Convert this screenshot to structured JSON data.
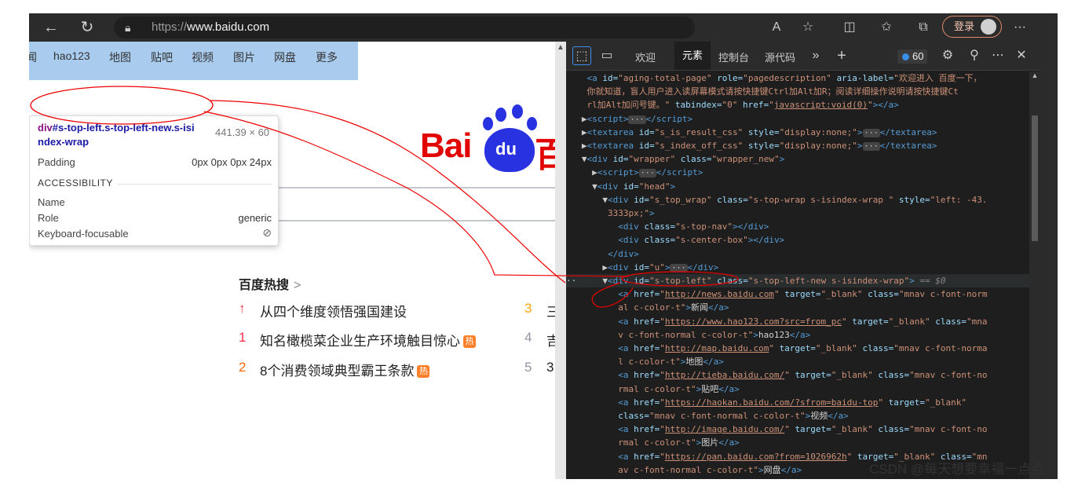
{
  "browser": {
    "url_prefix": "https://",
    "url_host": "www.baidu.com",
    "login_label": "登录",
    "icons": [
      "back-icon",
      "refresh-icon",
      "lock-icon",
      "read-aloud-icon",
      "favorite-add-icon",
      "split-screen-icon",
      "favorites-icon",
      "collections-icon",
      "more-icon"
    ]
  },
  "page": {
    "nav": [
      "闻",
      "hao123",
      "地图",
      "贴吧",
      "视频",
      "图片",
      "网盘",
      "更多"
    ],
    "logo_text": "Bai",
    "logo_du": "du",
    "logo_cut": "百",
    "hot_title": "百度热搜",
    "hot_arrow": ">",
    "hot_list": [
      {
        "idx": "↑",
        "text": "从四个维度领悟强国建设",
        "tag": "",
        "color": "#fe2d46"
      },
      {
        "idx": "1",
        "text": "知名橄榄菜企业生产环境触目惊心",
        "tag": "热",
        "color": "#fe2d46"
      },
      {
        "idx": "2",
        "text": "8个消费领域典型霸王条款",
        "tag": "热",
        "color": "#ff6600"
      }
    ],
    "hot_right": [
      {
        "idx": "3",
        "text": "三",
        "color": "#faa90e"
      },
      {
        "idx": "4",
        "text": "吉",
        "color": "#9195a3"
      },
      {
        "idx": "5",
        "text": "3",
        "color": "#9195a3"
      }
    ]
  },
  "tooltip": {
    "selector_tag": "div",
    "selector_rest": "#s-top-left.s-top-left-new.s-isi",
    "selector_rest2": "ndex-wrap",
    "size": "441.39 × 60",
    "padding_label": "Padding",
    "padding_value": "0px 0px 0px 24px",
    "accessibility": "ACCESSIBILITY",
    "name_label": "Name",
    "role_label": "Role",
    "role_value": "generic",
    "focus_label": "Keyboard-focusable"
  },
  "devtools": {
    "tabs": [
      "欢迎",
      "元素",
      "控制台",
      "源代码"
    ],
    "active_tab": "元素",
    "issues_count": "60",
    "selected_marker": "== $0"
  },
  "watermark": "CSDN @每天想要幸福一点点"
}
